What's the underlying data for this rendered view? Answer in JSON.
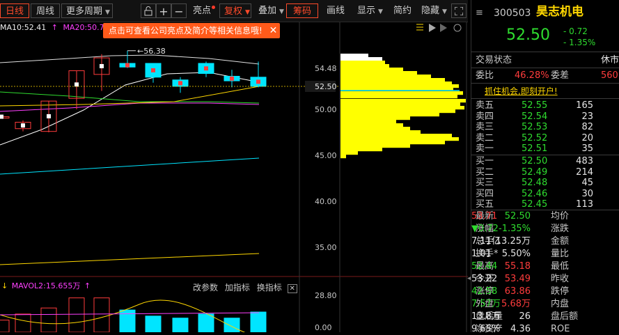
{
  "toolbar": {
    "daily": "日线",
    "weekly": "周线",
    "more_period": "更多周期",
    "highlights": "亮点",
    "restore": "复权",
    "overlay": "叠加",
    "chips": "筹码",
    "draw": "画线",
    "display": "显示",
    "simple": "简约",
    "hide": "隐藏"
  },
  "legend": {
    "ma10": "MA10:52.41",
    "ma20": "MA20:50.72",
    "tooltip": "点击可查看公司亮点及简介等相关信息哦!",
    "vol": "MAVOL2:15.655万",
    "change_param": "改参数",
    "add_indicator": "加指标",
    "swap_indicator": "换指标"
  },
  "chart_data": {
    "type": "candlestick",
    "high_label": "56.38",
    "price_axis": [
      "54.48",
      "52.50",
      "50.00",
      "45.00",
      "40.00",
      "35.00"
    ],
    "volume_axis": [
      "28.80",
      "0.00"
    ],
    "current_price": 52.5,
    "candles": [
      {
        "open": 49.2,
        "close": 49.2,
        "high": 49.3,
        "low": 49.1
      },
      {
        "open": 47.9,
        "close": 48.6,
        "high": 48.8,
        "low": 47.6
      },
      {
        "open": 47.6,
        "close": 50.9,
        "high": 50.9,
        "low": 47.5
      },
      {
        "open": 51.2,
        "close": 54.2,
        "high": 54.2,
        "low": 50.0
      },
      {
        "open": 53.8,
        "close": 55.6,
        "high": 56.0,
        "low": 52.0
      },
      {
        "open": 55.0,
        "close": 54.6,
        "high": 56.38,
        "low": 54.5
      },
      {
        "open": 55.0,
        "close": 53.5,
        "high": 55.0,
        "low": 52.9
      },
      {
        "open": 53.2,
        "close": 52.5,
        "high": 53.5,
        "low": 51.8
      },
      {
        "open": 55.0,
        "close": 53.9,
        "high": 55.2,
        "low": 53.5
      },
      {
        "open": 53.6,
        "close": 53.1,
        "high": 54.3,
        "low": 52.4
      },
      {
        "open": 53.5,
        "close": 52.5,
        "high": 55.2,
        "low": 52.4
      }
    ],
    "volumes": [
      6,
      9,
      12,
      17,
      17,
      11,
      8,
      7,
      9,
      7,
      10
    ]
  },
  "quote": {
    "code": "300503",
    "name": "昊志机电",
    "price": "52.50",
    "change": "- 0.72",
    "change_pct": "- 1.35%",
    "status_label": "交易状态",
    "status_value": "休市",
    "wb_label": "委比",
    "wb_value": "46.28%",
    "wc_label": "委差",
    "wc_value": "560",
    "banner": "抓住机会,即刻开户!"
  },
  "asks": [
    {
      "label": "卖五",
      "price": "52.55",
      "vol": "165"
    },
    {
      "label": "卖四",
      "price": "52.54",
      "vol": "23"
    },
    {
      "label": "卖三",
      "price": "52.53",
      "vol": "82"
    },
    {
      "label": "卖二",
      "price": "52.52",
      "vol": "20"
    },
    {
      "label": "卖一",
      "price": "52.51",
      "vol": "35"
    }
  ],
  "bids": [
    {
      "label": "买一",
      "price": "52.50",
      "vol": "483"
    },
    {
      "label": "买二",
      "price": "52.49",
      "vol": "214"
    },
    {
      "label": "买三",
      "price": "52.48",
      "vol": "45"
    },
    {
      "label": "买四",
      "price": "52.46",
      "vol": "30"
    },
    {
      "label": "买五",
      "price": "52.45",
      "vol": "113"
    }
  ],
  "stats": [
    {
      "l1": "最新",
      "v1": "52.50",
      "c1": "green",
      "l2": "均价",
      "v2": "53.71",
      "c2": "red"
    },
    {
      "l1": "涨幅",
      "v1": "-1.35%",
      "c1": "green",
      "l2": "涨跌",
      "v2": "▼0.72",
      "c2": "green"
    },
    {
      "l1": "总手",
      "v1": "13.25万",
      "c1": "white",
      "l2": "金额",
      "v2": "7.11亿",
      "c2": "white"
    },
    {
      "l1": "换手*",
      "v1": "5.50%",
      "c1": "white",
      "l2": "量比",
      "v2": "1.01",
      "c2": "white"
    },
    {
      "l1": "最高",
      "v1": "55.18",
      "c1": "red",
      "l2": "最低",
      "v2": "52.44",
      "c2": "green"
    },
    {
      "l1": "今开",
      "v1": "53.49",
      "c1": "red",
      "l2": "昨收",
      "v2": "53.22",
      "c2": "white"
    },
    {
      "l1": "涨停",
      "v1": "63.86",
      "c1": "red",
      "l2": "跌停",
      "v2": "42.58",
      "c2": "green"
    },
    {
      "l1": "外盘",
      "v1": "5.68万",
      "c1": "red",
      "l2": "内盘",
      "v2": "7.57万",
      "c2": "green"
    },
    {
      "l1": "盘后量",
      "v1": "26",
      "c1": "white",
      "l2": "盘后额",
      "v2": "13.8万",
      "c2": "white"
    },
    {
      "l1": "净资产",
      "v1": "4.36",
      "c1": "white",
      "l2": "ROE",
      "v2": "9.65%",
      "c2": "white"
    }
  ]
}
